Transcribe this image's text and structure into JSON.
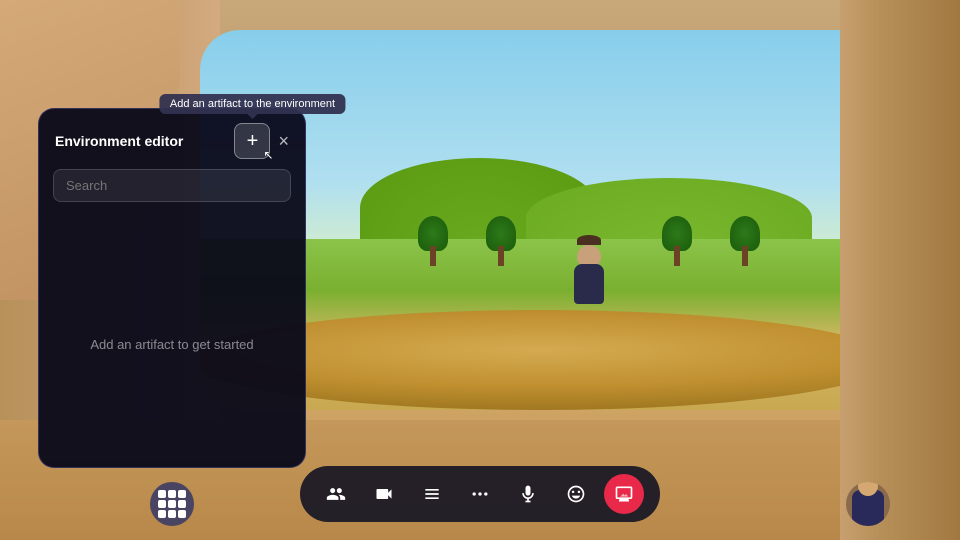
{
  "scene": {
    "background_desc": "VR environment with arch walls and nature view"
  },
  "tooltip": {
    "text": "Add an artifact to the environment"
  },
  "env_editor": {
    "title": "Environment editor",
    "add_button_label": "+",
    "close_button_label": "×",
    "search_placeholder": "Search",
    "empty_state_text": "Add an artifact to get started"
  },
  "toolbar": {
    "buttons": [
      {
        "id": "people",
        "label": "People",
        "icon": "people"
      },
      {
        "id": "camera",
        "label": "Camera",
        "icon": "camera"
      },
      {
        "id": "share",
        "label": "Share",
        "icon": "share"
      },
      {
        "id": "more",
        "label": "More",
        "icon": "more"
      },
      {
        "id": "mic",
        "label": "Microphone",
        "icon": "mic"
      },
      {
        "id": "emoji",
        "label": "Emoji",
        "icon": "emoji"
      },
      {
        "id": "share-screen",
        "label": "Share screen",
        "icon": "share-screen",
        "active": true
      }
    ],
    "apps_label": "Apps",
    "avatar_label": "Avatar"
  }
}
